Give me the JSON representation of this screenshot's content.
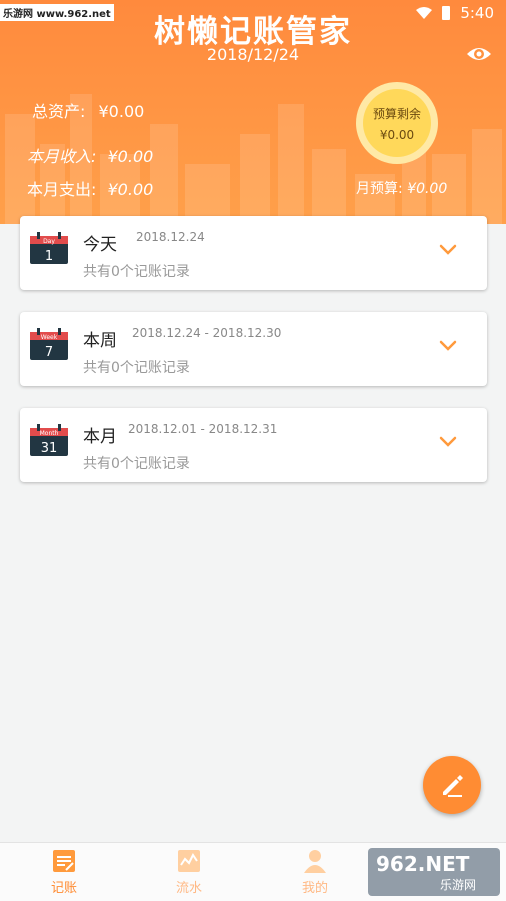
{
  "watermark_top": "乐游网 www.962.net",
  "status": {
    "time": "5:40"
  },
  "header": {
    "title": "树懒记账管家",
    "date": "2018/12/24",
    "total_assets_label": "总资产:",
    "total_assets_value": "¥0.00",
    "month_income_label": "本月收入:",
    "month_income_value": "¥0.00",
    "month_expense_label": "本月支出:",
    "month_expense_value": "¥0.00",
    "budget_remaining_label": "预算剩余",
    "budget_remaining_value": "¥0.00",
    "month_budget_label": "月预算:",
    "month_budget_value": "¥0.00"
  },
  "cards": [
    {
      "cal_tag": "Day",
      "cal_num": "1",
      "title": "今天",
      "range": "2018.12.24",
      "sub": "共有0个记账记录"
    },
    {
      "cal_tag": "Week",
      "cal_num": "7",
      "title": "本周",
      "range": "2018.12.24 - 2018.12.30",
      "sub": "共有0个记账记录"
    },
    {
      "cal_tag": "Month",
      "cal_num": "31",
      "title": "本月",
      "range": "2018.12.01 - 2018.12.31",
      "sub": "共有0个记账记录"
    }
  ],
  "tabs": [
    {
      "label": "记账",
      "icon": "note-edit-icon"
    },
    {
      "label": "流水",
      "icon": "chart-icon"
    },
    {
      "label": "我的",
      "icon": "user-icon"
    }
  ],
  "watermark_bottom": {
    "brand": "962.NET",
    "sub": "乐游网"
  },
  "colors": {
    "accent": "#ff8c33",
    "header_top": "#ff8a3d",
    "badge": "#ffd85a"
  }
}
